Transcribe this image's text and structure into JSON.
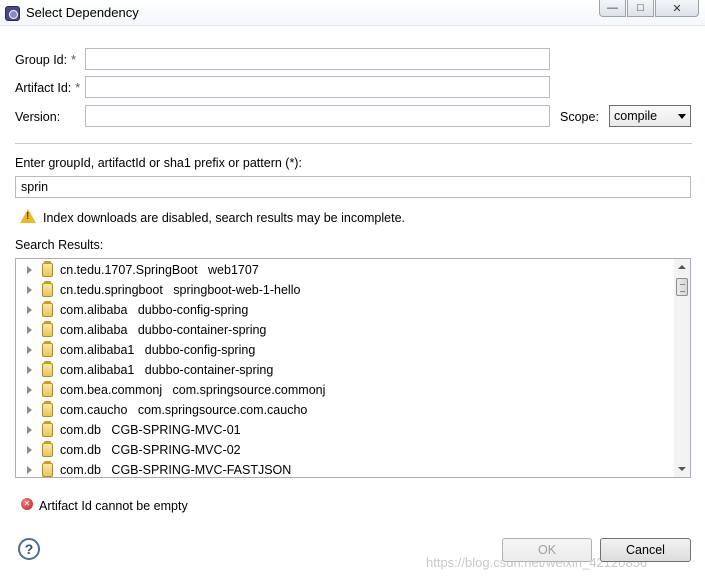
{
  "window": {
    "title": "Select Dependency",
    "controls": [
      "minimize",
      "maximize",
      "close"
    ]
  },
  "form": {
    "group_id_label": "Group Id:",
    "artifact_id_label": "Artifact Id:",
    "required_marker": "*",
    "version_label": "Version:",
    "scope_label": "Scope:",
    "group_id_value": "",
    "artifact_id_value": "",
    "version_value": "",
    "scope_value": "compile"
  },
  "search": {
    "label": "Enter groupId, artifactId or sha1 prefix or pattern (*):",
    "value": "sprin",
    "warning": "Index downloads are disabled, search results may be incomplete.",
    "results_label": "Search Results:"
  },
  "results": [
    {
      "group": "cn.tedu.1707.SpringBoot",
      "artifact": "web1707"
    },
    {
      "group": "cn.tedu.springboot",
      "artifact": "springboot-web-1-hello"
    },
    {
      "group": "com.alibaba",
      "artifact": "dubbo-config-spring"
    },
    {
      "group": "com.alibaba",
      "artifact": "dubbo-container-spring"
    },
    {
      "group": "com.alibaba1",
      "artifact": "dubbo-config-spring"
    },
    {
      "group": "com.alibaba1",
      "artifact": "dubbo-container-spring"
    },
    {
      "group": "com.bea.commonj",
      "artifact": "com.springsource.commonj"
    },
    {
      "group": "com.caucho",
      "artifact": "com.springsource.com.caucho"
    },
    {
      "group": "com.db",
      "artifact": "CGB-SPRING-MVC-01"
    },
    {
      "group": "com.db",
      "artifact": "CGB-SPRING-MVC-02"
    },
    {
      "group": "com.db",
      "artifact": "CGB-SPRING-MVC-FASTJSON"
    }
  ],
  "status": {
    "error": "Artifact Id cannot be empty"
  },
  "buttons": {
    "ok": "OK",
    "cancel": "Cancel",
    "help": "?"
  },
  "watermark": "https://blog.csdn.net/weixin_42120856",
  "colors": {
    "warning": "#e8b82e",
    "error": "#c41a1a"
  }
}
